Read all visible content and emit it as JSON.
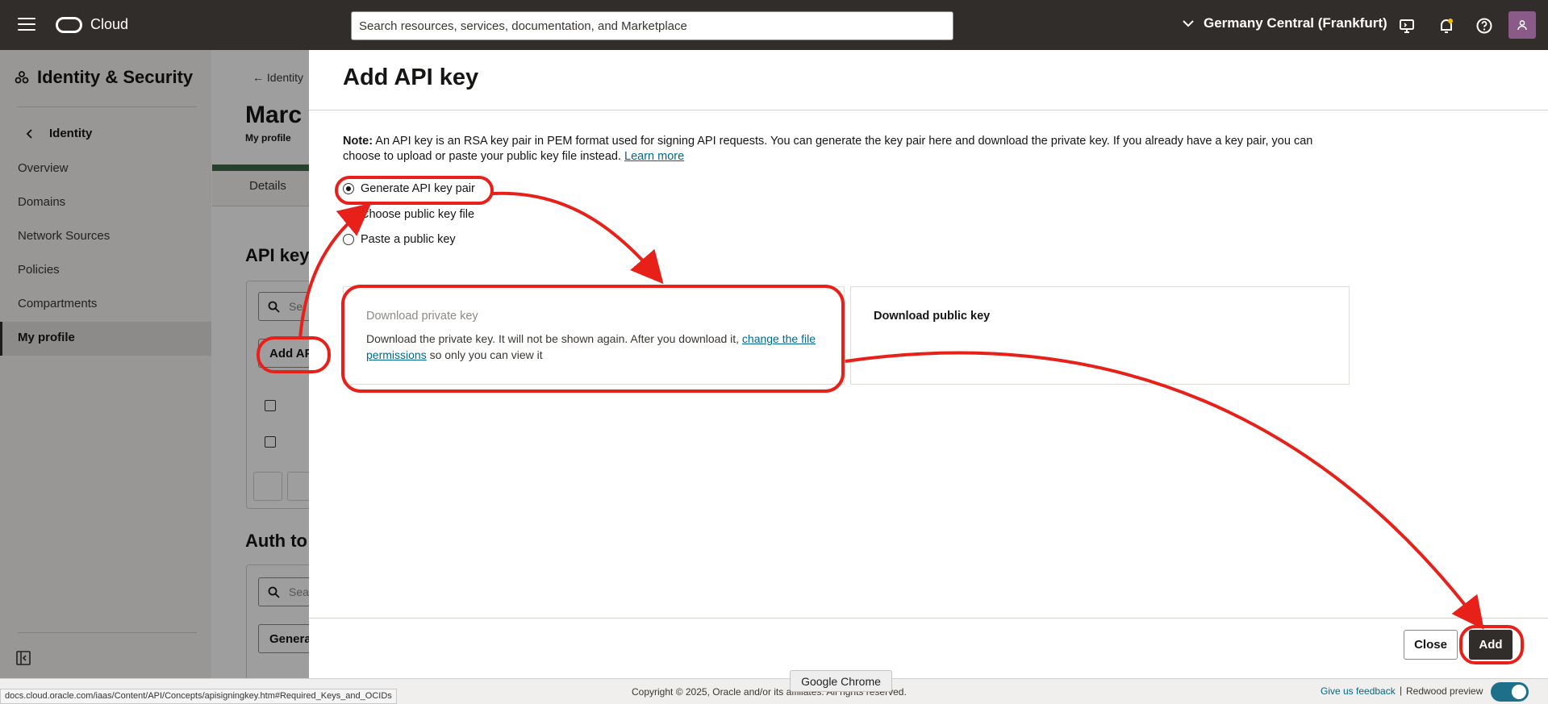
{
  "topbar": {
    "brand": "Cloud",
    "search_placeholder": "Search resources, services, documentation, and Marketplace",
    "region": "Germany Central (Frankfurt)"
  },
  "sidebar": {
    "title": "Identity & Security",
    "back_label": "Identity",
    "items": [
      "Overview",
      "Domains",
      "Network Sources",
      "Policies",
      "Compartments"
    ],
    "active_item": "My profile"
  },
  "background_page": {
    "breadcrumb": "Identity",
    "heading": "Marc (",
    "subheading": "My profile",
    "tab_details": "Details",
    "section_api_keys": "API key",
    "section_auth_tokens": "Auth to",
    "search_placeholder_1": "Se",
    "search_placeholder_2": "Sea",
    "add_api_button": "Add AP",
    "generate_button": "Genera"
  },
  "drawer": {
    "title": "Add API key",
    "note_label": "Note:",
    "note_text": "An API key is an RSA key pair in PEM format used for signing API requests. You can generate the key pair here and download the private key. If you already have a key pair, you can choose to upload or paste your public key file instead.",
    "learn_more": "Learn more",
    "options": [
      {
        "label": "Generate API key pair",
        "checked": true
      },
      {
        "label": "Choose public key file",
        "checked": false
      },
      {
        "label": "Paste a public key",
        "checked": false
      }
    ],
    "private_card": {
      "title": "Download private key",
      "desc_before": "Download the private key. It will not be shown again. After you download it,",
      "desc_link": "change the file permissions",
      "desc_after": "so only you can view it"
    },
    "public_card": {
      "title": "Download public key"
    },
    "close_button": "Close",
    "add_button": "Add"
  },
  "footer": {
    "copyright": "Copyright © 2025, Oracle and/or its affiliates. All rights reserved.",
    "feedback": "Give us feedback",
    "separator": "|",
    "redwood": "Redwood preview",
    "redwood_toggle_on": true
  },
  "browser": {
    "status_url": "docs.cloud.oracle.com/iaas/Content/API/Concepts/apisigningkey.htm#Required_Keys_and_OCIDs",
    "tooltip": "Google Chrome"
  },
  "colors": {
    "topbar": "#312d2a",
    "annotation": "#e8201a",
    "link": "#00688c",
    "primary_button": "#312d2a"
  }
}
